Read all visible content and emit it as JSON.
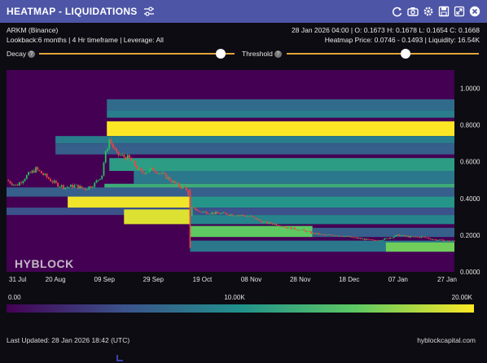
{
  "window": {
    "title": "HEATMAP - LIQUIDATIONS"
  },
  "icons": {
    "settings": "sliders-icon",
    "toolbar": [
      "refresh-icon",
      "camera-icon",
      "gear-icon",
      "save-icon",
      "expand-icon",
      "close-icon"
    ]
  },
  "info": {
    "asset": "ARKM (Binance)",
    "params": "Lookback:6 months | 4 Hr timeframe | Leverage: All",
    "ohlc": "28 Jan 2026 04:00 | O: 0.1673 H: 0.1678 L: 0.1654 C: 0.1668",
    "heatmap_info": "Heatmap Price: 0.0746 - 0.1493 | Liquidity: 16.54K"
  },
  "controls": {
    "decay_label": "Decay",
    "threshold_label": "Threshold",
    "decay_value": 0.93,
    "threshold_value": 0.62
  },
  "watermark": "HYBLOCK",
  "colorbar": {
    "min_label": "0.00",
    "mid_label": "10.00K",
    "max_label": "20.00K"
  },
  "footer": {
    "updated": "Last Updated: 28 Jan 2026 18:42 (UTC)",
    "source": "hyblockcapital.com"
  },
  "colors": {
    "titlebar": "#4d55a6",
    "slider_track": "#e0a53a",
    "background": "#0c0c12",
    "heat_low": "#440154",
    "heat_mid": "#21918c",
    "heat_high": "#fde725",
    "candle_up": "#22c55e",
    "candle_down": "#ef4444"
  },
  "chart_data": {
    "type": "heatmap",
    "x_ticks": [
      "31 Jul",
      "20 Aug",
      "09 Sep",
      "29 Sep",
      "19 Oct",
      "08 Nov",
      "28 Nov",
      "18 Dec",
      "07 Jan",
      "27 Jan"
    ],
    "y_ticks": [
      "1.0000",
      "0.8000",
      "0.6000",
      "0.4000",
      "0.2000",
      "0.0000"
    ],
    "ylim": [
      0,
      1.1
    ],
    "x_range_days": [
      0,
      183
    ],
    "heat_bands": [
      {
        "start": 41,
        "end": 183,
        "ylo": 0.88,
        "yhi": 0.94,
        "intensity": 0.35
      },
      {
        "start": 41,
        "end": 183,
        "ylo": 0.84,
        "yhi": 0.88,
        "intensity": 0.42
      },
      {
        "start": 41,
        "end": 183,
        "ylo": 0.74,
        "yhi": 0.82,
        "intensity": 1.0
      },
      {
        "start": 20,
        "end": 183,
        "ylo": 0.7,
        "yhi": 0.74,
        "intensity": 0.42
      },
      {
        "start": 20,
        "end": 183,
        "ylo": 0.64,
        "yhi": 0.7,
        "intensity": 0.3
      },
      {
        "start": 42,
        "end": 183,
        "ylo": 0.55,
        "yhi": 0.62,
        "intensity": 0.55
      },
      {
        "start": 52,
        "end": 183,
        "ylo": 0.48,
        "yhi": 0.55,
        "intensity": 0.4
      },
      {
        "start": 40,
        "end": 183,
        "ylo": 0.41,
        "yhi": 0.48,
        "intensity": 0.62
      },
      {
        "start": 0,
        "end": 183,
        "ylo": 0.41,
        "yhi": 0.46,
        "intensity": 0.3
      },
      {
        "start": 25,
        "end": 75,
        "ylo": 0.35,
        "yhi": 0.41,
        "intensity": 0.98
      },
      {
        "start": 75,
        "end": 183,
        "ylo": 0.35,
        "yhi": 0.41,
        "intensity": 0.52
      },
      {
        "start": 0,
        "end": 183,
        "ylo": 0.31,
        "yhi": 0.35,
        "intensity": 0.25
      },
      {
        "start": 48,
        "end": 75,
        "ylo": 0.26,
        "yhi": 0.34,
        "intensity": 0.95
      },
      {
        "start": 75,
        "end": 183,
        "ylo": 0.26,
        "yhi": 0.31,
        "intensity": 0.45
      },
      {
        "start": 75,
        "end": 125,
        "ylo": 0.19,
        "yhi": 0.25,
        "intensity": 0.75
      },
      {
        "start": 125,
        "end": 183,
        "ylo": 0.19,
        "yhi": 0.24,
        "intensity": 0.3
      },
      {
        "start": 75,
        "end": 183,
        "ylo": 0.11,
        "yhi": 0.17,
        "intensity": 0.4
      },
      {
        "start": 155,
        "end": 183,
        "ylo": 0.11,
        "yhi": 0.16,
        "intensity": 0.78
      }
    ],
    "price_series": [
      [
        0,
        0.5
      ],
      [
        4,
        0.47
      ],
      [
        8,
        0.52
      ],
      [
        12,
        0.56
      ],
      [
        16,
        0.52
      ],
      [
        20,
        0.48
      ],
      [
        24,
        0.46
      ],
      [
        28,
        0.47
      ],
      [
        32,
        0.45
      ],
      [
        36,
        0.48
      ],
      [
        39,
        0.53
      ],
      [
        40,
        0.62
      ],
      [
        42,
        0.72
      ],
      [
        45,
        0.64
      ],
      [
        50,
        0.62
      ],
      [
        55,
        0.54
      ],
      [
        60,
        0.56
      ],
      [
        65,
        0.52
      ],
      [
        70,
        0.47
      ],
      [
        74,
        0.45
      ],
      [
        75,
        0.3
      ],
      [
        76,
        0.36
      ],
      [
        78,
        0.33
      ],
      [
        85,
        0.32
      ],
      [
        95,
        0.31
      ],
      [
        100,
        0.3
      ],
      [
        105,
        0.27
      ],
      [
        110,
        0.26
      ],
      [
        115,
        0.24
      ],
      [
        120,
        0.23
      ],
      [
        125,
        0.21
      ],
      [
        130,
        0.2
      ],
      [
        135,
        0.2
      ],
      [
        140,
        0.19
      ],
      [
        145,
        0.18
      ],
      [
        150,
        0.17
      ],
      [
        155,
        0.18
      ],
      [
        160,
        0.2
      ],
      [
        165,
        0.19
      ],
      [
        170,
        0.19
      ],
      [
        175,
        0.175
      ],
      [
        180,
        0.168
      ],
      [
        183,
        0.167
      ]
    ],
    "price_spike": {
      "day": 75,
      "low": 0.13,
      "high": 0.45
    }
  }
}
